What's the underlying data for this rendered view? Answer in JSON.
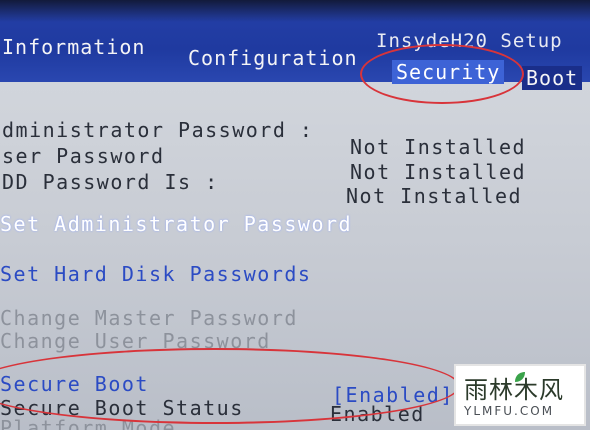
{
  "menu": {
    "tabs": [
      {
        "label": "Information"
      },
      {
        "label": "Configuration"
      },
      {
        "label": "Security"
      },
      {
        "label": "Boot"
      }
    ],
    "brand": "InsydeH20 Setup",
    "active_tab": "Security"
  },
  "security": {
    "admin_password_label": "dministrator Password :",
    "admin_password_value": "Not Installed",
    "user_password_label": "ser Password",
    "user_password_value": "Not Installed",
    "hdd_password_label": "DD Password Is :",
    "hdd_password_value": "Not Installed",
    "set_admin_password": "Set Administrator Password",
    "set_hdd_passwords": "Set Hard Disk Passwords",
    "change_master_password": "Change Master Password",
    "change_user_password": "Change User Password",
    "secure_boot_label": "Secure Boot",
    "secure_boot_value": "[Enabled]",
    "secure_boot_status_label": "Secure Boot Status",
    "secure_boot_status_value": "Enabled",
    "platform_mode_label": "Platform Mode"
  },
  "watermark": {
    "name": "雨林木风",
    "url": "YLMFU.COM"
  },
  "colors": {
    "menu_bar": "#1f3aa0",
    "active_tab": "#3d63d6",
    "annotation": "#d8343a"
  }
}
